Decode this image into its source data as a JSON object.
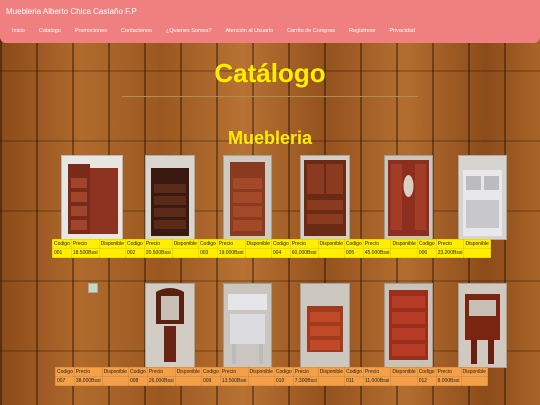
{
  "nav": {
    "brand": "Muebleria Alberto Chica Castaño F.P",
    "items": [
      "Inicio",
      "Catalogo",
      "Promociones",
      "Contactenos",
      "¿Quienes Somos?",
      "Atención al Usuario",
      "Carrito de Compras",
      "Registrese",
      "Privacidad"
    ]
  },
  "page_title": "Catálogo",
  "section_title": "Muebleria",
  "table_headers": {
    "code": "Codigo",
    "price": "Precio",
    "status": "Disponible"
  },
  "row1": {
    "table_bg": "#ffee00",
    "products": [
      {
        "code": "001",
        "price": "18.500Bssi"
      },
      {
        "code": "002",
        "price": "20.500Bssi"
      },
      {
        "code": "003",
        "price": "19.000Bssi"
      },
      {
        "code": "004",
        "price": "60.000Bssi"
      },
      {
        "code": "005",
        "price": "45.000Bssi"
      },
      {
        "code": "006",
        "price": "23.200Bssi"
      }
    ]
  },
  "row2": {
    "table_bg": "#f4a049",
    "products": [
      {
        "code": "007",
        "price": "38.000Bssi"
      },
      {
        "code": "008",
        "price": "26.000Bssi"
      },
      {
        "code": "009",
        "price": "13.500Bssi"
      },
      {
        "code": "010",
        "price": "7.300Bssi"
      },
      {
        "code": "011",
        "price": "11.000Bssi"
      },
      {
        "code": "012",
        "price": "8.000Bssi"
      }
    ]
  }
}
